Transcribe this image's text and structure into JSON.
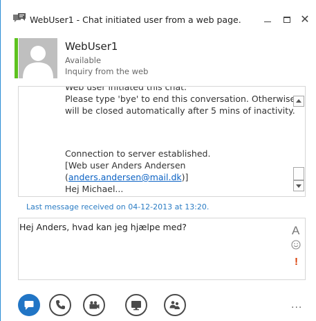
{
  "window": {
    "title": "WebUser1 - Chat initiated user from a web page.",
    "minimize_label": "",
    "maximize_label": "",
    "close_label": "✕"
  },
  "contact": {
    "name": "WebUser1",
    "status": "Available",
    "note": "Inquiry from the web",
    "presence_color": "#5dc21e"
  },
  "conversation": {
    "lines_top": [
      "Web user initiated this chat.",
      "Please type 'bye' to end this conversation. Otherwise",
      "will be closed automatically after 5 mins of inactivity."
    ],
    "server_line": "Connection to server established.",
    "web_user_line": "[Web user Anders Andersen",
    "email_open": "(",
    "email": "anders.andersen@mail.dk",
    "email_close": ")]",
    "greeting": "Hej Michael..."
  },
  "status_line": "Last message received on 04-12-2013 at 13:20.",
  "compose": {
    "value": "Hej Anders, hvad kan jeg hjælpe med?",
    "font_label": "A",
    "important_label": "!"
  },
  "toolbar": {
    "icons": [
      "im-icon",
      "phone-icon",
      "video-icon",
      "present-icon",
      "people-icon"
    ],
    "more_label": "..."
  },
  "colors": {
    "accent": "#2175c5",
    "link": "#0b62c4",
    "important": "#d83b01"
  }
}
